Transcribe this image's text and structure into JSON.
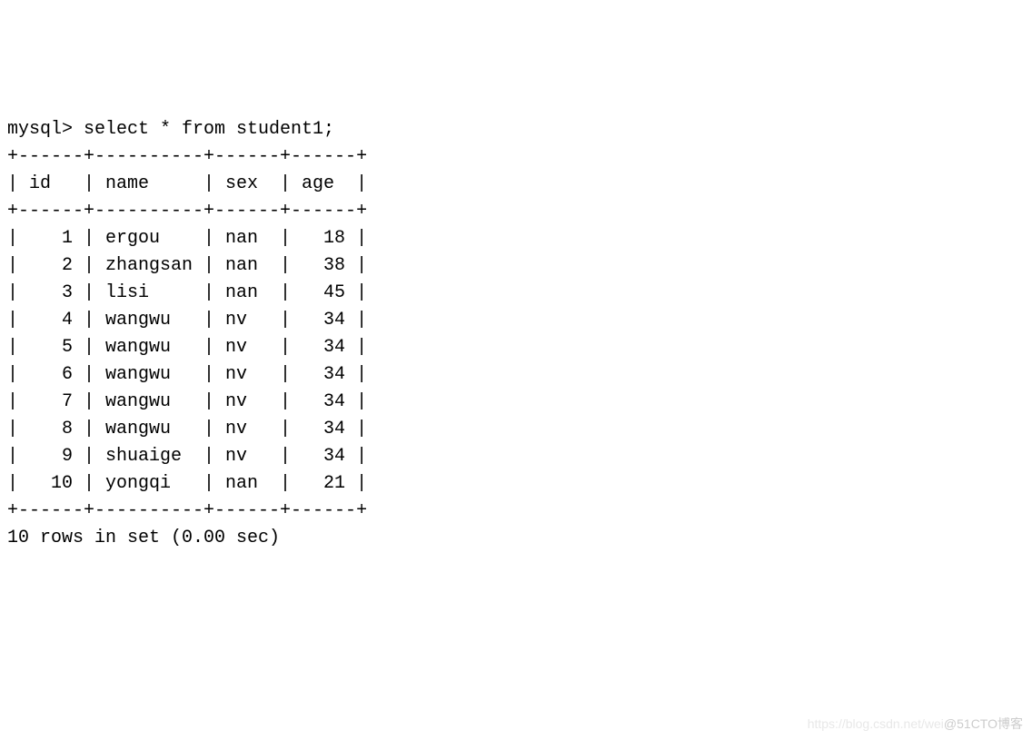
{
  "terminal": {
    "prompt": "mysql> ",
    "query": "select * from student1;",
    "header_border": "+------+----------+------+------+",
    "header_row": "| id   | name     | sex  | age  |",
    "rows": [
      "|    1 | ergou    | nan  |   18 |",
      "|    2 | zhangsan | nan  |   38 |",
      "|    3 | lisi     | nan  |   45 |",
      "|    4 | wangwu   | nv   |   34 |",
      "|    5 | wangwu   | nv   |   34 |",
      "|    6 | wangwu   | nv   |   34 |",
      "|    7 | wangwu   | nv   |   34 |",
      "|    8 | wangwu   | nv   |   34 |",
      "|    9 | shuaige  | nv   |   34 |",
      "|   10 | yongqi   | nan  |   21 |"
    ],
    "footer": "10 rows in set (0.00 sec)"
  },
  "chart_data": {
    "type": "table",
    "title": "student1",
    "columns": [
      "id",
      "name",
      "sex",
      "age"
    ],
    "rows": [
      {
        "id": 1,
        "name": "ergou",
        "sex": "nan",
        "age": 18
      },
      {
        "id": 2,
        "name": "zhangsan",
        "sex": "nan",
        "age": 38
      },
      {
        "id": 3,
        "name": "lisi",
        "sex": "nan",
        "age": 45
      },
      {
        "id": 4,
        "name": "wangwu",
        "sex": "nv",
        "age": 34
      },
      {
        "id": 5,
        "name": "wangwu",
        "sex": "nv",
        "age": 34
      },
      {
        "id": 6,
        "name": "wangwu",
        "sex": "nv",
        "age": 34
      },
      {
        "id": 7,
        "name": "wangwu",
        "sex": "nv",
        "age": 34
      },
      {
        "id": 8,
        "name": "wangwu",
        "sex": "nv",
        "age": 34
      },
      {
        "id": 9,
        "name": "shuaige",
        "sex": "nv",
        "age": 34
      },
      {
        "id": 10,
        "name": "yongqi",
        "sex": "nan",
        "age": 21
      }
    ]
  },
  "watermark": {
    "faint": "https://blog.csdn.net/wei",
    "text": "@51CTO博客"
  }
}
